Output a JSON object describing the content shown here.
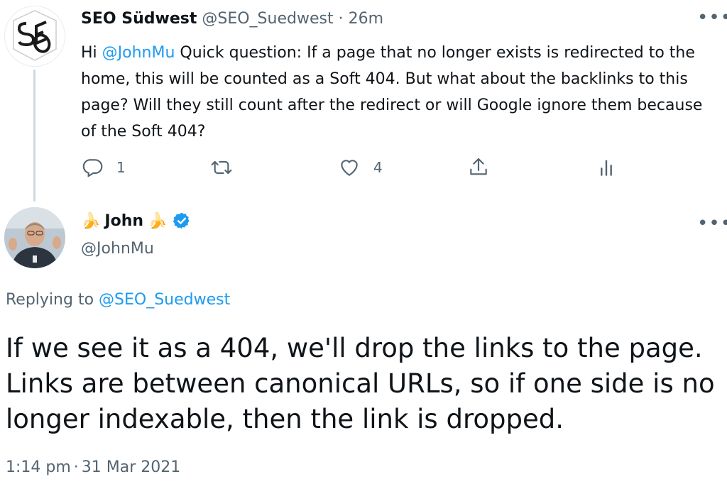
{
  "tweet1": {
    "display_name": "SEO Südwest",
    "handle": "@SEO_Suedwest",
    "separator": "·",
    "time": "26m",
    "text_greeting": "Hi ",
    "text_mention": "@JohnMu",
    "text_body": " Quick question: If a page that no longer exists is redirected to the home, this will be counted as a Soft 404. But what about the backlinks to this page? Will they still count after the redirect or will Google ignore them because of the Soft 404?",
    "reply_count": "1",
    "retweet_count": "",
    "like_count": "4",
    "more_label": "•••"
  },
  "tweet2": {
    "display_name": "John",
    "emoji_left": "🍌",
    "emoji_right": "🍌",
    "handle": "@JohnMu",
    "more_label": "•••",
    "replying_prefix": "Replying to ",
    "replying_handle": "@SEO_Suedwest",
    "text": "If we see it as a 404, we'll drop the links to the page. Links are between canonical URLs, so if one side is no longer indexable, then the link is dropped.",
    "time": "1:14 pm",
    "separator": "·",
    "date": "31 Mar 2021"
  },
  "colors": {
    "link": "#1d9bf0",
    "secondary_text": "#536471",
    "thread_line": "#cfd9de",
    "verified": "#1d9bf0"
  },
  "icons": {
    "reply": "reply-icon",
    "retweet": "retweet-icon",
    "like": "heart-icon",
    "share": "share-icon",
    "analytics": "analytics-icon",
    "verified": "verified-badge-icon"
  }
}
